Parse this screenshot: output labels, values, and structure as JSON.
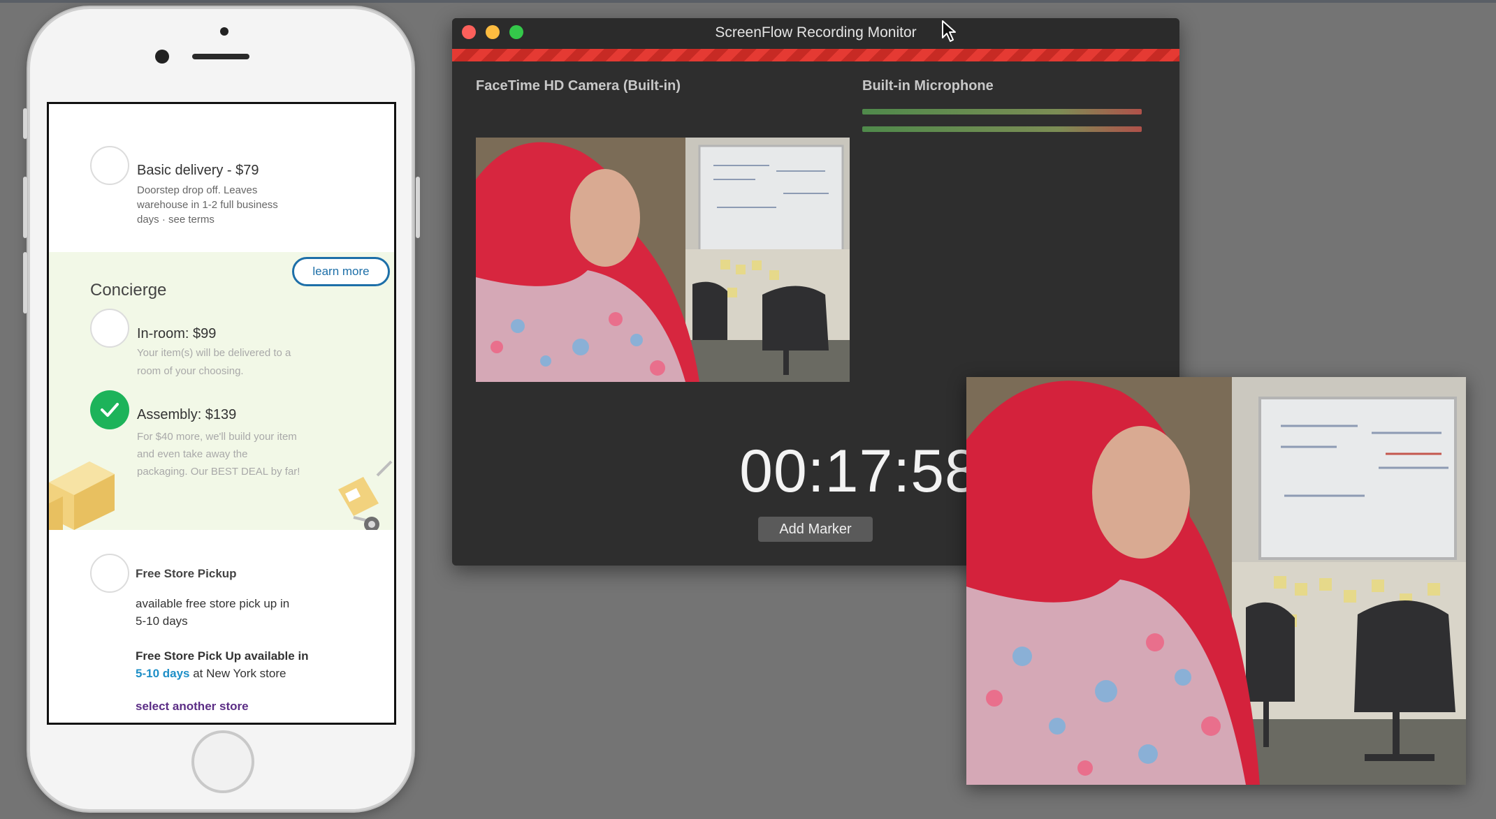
{
  "phone": {
    "basic": {
      "title": "Basic delivery - $79",
      "desc1": "Doorstep drop off. Leaves",
      "desc2": "warehouse in 1-2 full business",
      "desc3": "days  ·  see terms"
    },
    "concierge": {
      "heading": "Concierge",
      "learn_more": "learn more",
      "in_room": {
        "title": "In-room: $99",
        "desc1": "Your item(s) will be delivered to a",
        "desc2": "room of your choosing."
      },
      "assembly": {
        "title": "Assembly: $139",
        "desc1": "For $40 more, we'll build your item",
        "desc2": "and even take away the",
        "desc3": "packaging. Our BEST DEAL by far!"
      }
    },
    "pickup": {
      "title": "Free Store Pickup",
      "desc1": "available free store pick up in",
      "desc2": "5-10 days",
      "avail1": "Free Store Pick Up available in",
      "avail2_link": "5-10 days",
      "avail2_rest": " at New York store",
      "select_store": "select another store"
    }
  },
  "monitor": {
    "title": "ScreenFlow Recording Monitor",
    "camera_label": "FaceTime HD Camera (Built-in)",
    "mic_label": "Built-in Microphone",
    "timer": "00:17:58",
    "add_marker": "Add Marker"
  },
  "colors": {
    "record_bar": "#e53a33",
    "check_green": "#1db35a",
    "learn_more_blue": "#1d6fa8",
    "concierge_bg": "#f2f8e7",
    "desktop_bg": "#747474"
  },
  "icons": {
    "window_close": "close-traffic-light-icon",
    "window_minimize": "minimize-traffic-light-icon",
    "window_zoom": "zoom-traffic-light-icon",
    "selected": "checkmark-icon",
    "cursor": "mouse-pointer-icon"
  }
}
